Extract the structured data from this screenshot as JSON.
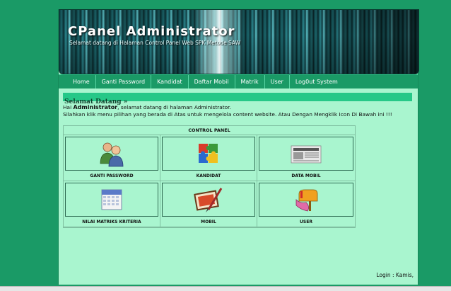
{
  "header": {
    "title": "CPanel Administrator",
    "subtitle": "Selamat datang di Halaman Control Panel Web SPK Metode SAW"
  },
  "nav": {
    "items": [
      "Home",
      "Ganti Password",
      "Kandidat",
      "Daftar Mobil",
      "Matrik",
      "User",
      "Log0ut System"
    ]
  },
  "welcome": {
    "heading": "Selamat Datang »",
    "greeting_prefix": "Hai ",
    "username": "Administrator",
    "greeting_suffix": ", selamat datang di halaman Administrator.",
    "instructions": "Silahkan klik menu pilihan yang berada di Atas untuk mengelola content website. Atau Dengan Mengklik Icon Di Bawah ini !!!"
  },
  "control_panel": {
    "title": "CONTROL PANEL",
    "items": [
      {
        "label": "GANTI PASSWORD",
        "icon": "users-icon"
      },
      {
        "label": "KANDIDAT",
        "icon": "puzzle-icon"
      },
      {
        "label": "DATA MOBIL",
        "icon": "newspaper-icon"
      },
      {
        "label": "NILAI MATRIKS KRITERIA",
        "icon": "calendar-icon"
      },
      {
        "label": "MOBIL",
        "icon": "paint-brush-icon"
      },
      {
        "label": "USER",
        "icon": "mailbox-icon"
      }
    ]
  },
  "footer": {
    "login": "Login : Kamis,"
  },
  "colors": {
    "background": "#1a9a66",
    "content": "#a9f5cf",
    "accent": "#26c888"
  }
}
